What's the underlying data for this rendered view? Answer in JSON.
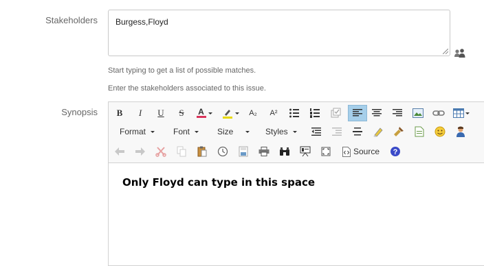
{
  "stakeholders": {
    "label": "Stakeholders",
    "value": "Burgess,Floyd",
    "help_1": "Start typing to get a list of possible matches.",
    "help_2": "Enter the stakeholders associated to this issue."
  },
  "synopsis": {
    "label": "Synopsis",
    "toolbar": {
      "format": "Format",
      "font": "Font",
      "size": "Size",
      "styles": "Styles",
      "source": "Source"
    },
    "content": "Only Floyd can type in this space"
  },
  "icons": {
    "bold": "B",
    "italic": "I",
    "underline": "U",
    "strike": "S",
    "text_color": "A",
    "subscript": "A₂",
    "superscript": "A²"
  }
}
